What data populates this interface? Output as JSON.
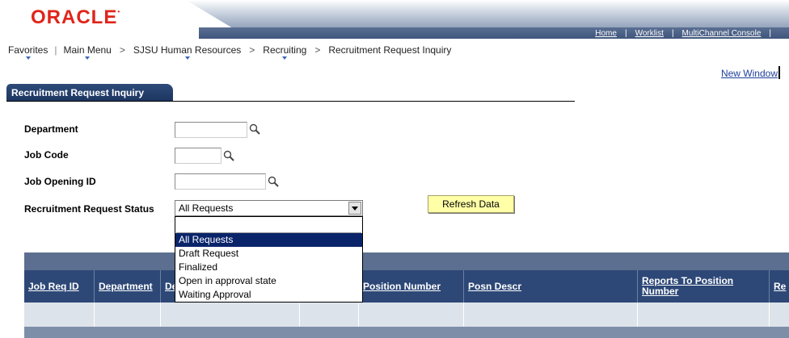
{
  "header": {
    "logo": "ORACLE",
    "links": [
      "Home",
      "Worklist",
      "MultiChannel Console"
    ]
  },
  "breadcrumb": {
    "items": [
      "Favorites",
      "Main Menu",
      "SJSU Human Resources",
      "Recruiting",
      "Recruitment Request Inquiry"
    ]
  },
  "new_window": "New Window",
  "tab": {
    "label": "Recruitment Request Inquiry"
  },
  "form": {
    "department_label": "Department",
    "department_value": "",
    "job_code_label": "Job Code",
    "job_code_value": "",
    "job_opening_label": "Job Opening ID",
    "job_opening_value": "",
    "status_label": "Recruitment Request Status",
    "status_value": "All Requests",
    "status_options": [
      "All Requests",
      "Draft Request",
      "Finalized",
      "Open in approval state",
      "Waiting Approval"
    ],
    "refresh_label": "Refresh Data"
  },
  "grid": {
    "columns": [
      "Job Req ID",
      "Department",
      "De",
      "Position Number",
      "Posn Descr",
      "Reports To Position Number",
      "Re"
    ]
  },
  "colors": {
    "oracle_red": "#e0251b",
    "header_blue": "#2d4877",
    "tab_blue": "#1c3560",
    "button_yellow": "#ffffa8",
    "selection_blue": "#0a246a"
  }
}
